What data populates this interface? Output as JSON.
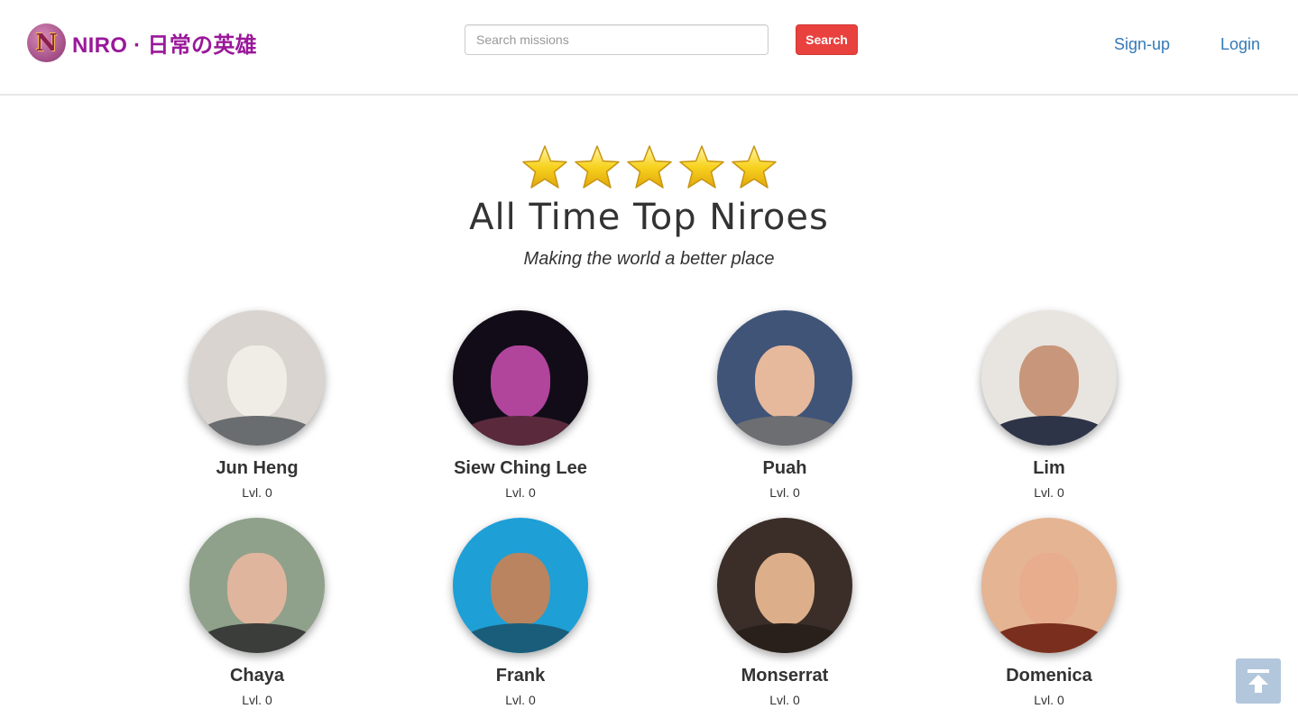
{
  "header": {
    "brand_name": "NIRO · 日常の英雄",
    "brand_logo_letter": "N",
    "search_placeholder": "Search missions",
    "search_value": "",
    "search_button": "Search",
    "signup": "Sign-up",
    "login": "Login"
  },
  "hero": {
    "star_count": 5,
    "title": "All Time Top Niroes",
    "subtitle": "Making the world a better place"
  },
  "heroes": [
    {
      "name": "Jun Heng",
      "level": "Lvl. 0",
      "bg": "#d9d4cf",
      "face": "#f0ece6",
      "body": "#6a6d6f"
    },
    {
      "name": "Siew Ching Lee",
      "level": "Lvl. 0",
      "bg": "#120c18",
      "face": "#b0459b",
      "body": "#5a2a3c"
    },
    {
      "name": "Puah",
      "level": "Lvl. 0",
      "bg": "#3f5477",
      "face": "#e6b89c",
      "body": "#6d6e72"
    },
    {
      "name": "Lim",
      "level": "Lvl. 0",
      "bg": "#e8e4df",
      "face": "#c8967a",
      "body": "#2e3447"
    },
    {
      "name": "Chaya",
      "level": "Lvl. 0",
      "bg": "#8fa18a",
      "face": "#e0b59e",
      "body": "#3b3d3a"
    },
    {
      "name": "Frank",
      "level": "Lvl. 0",
      "bg": "#1e9fd6",
      "face": "#b9845f",
      "body": "#1a5d7a"
    },
    {
      "name": "Monserrat",
      "level": "Lvl. 0",
      "bg": "#3b2e28",
      "face": "#dcae8a",
      "body": "#2a201b"
    },
    {
      "name": "Domenica",
      "level": "Lvl. 0",
      "bg": "#e5b493",
      "face": "#e8ad8c",
      "body": "#7a2f1e"
    }
  ],
  "colors": {
    "brand": "#9a189a",
    "search_button": "#e8413e",
    "nav_link": "#337ab7",
    "back_to_top": "#b3c7dc"
  },
  "icons": {
    "star": "star-icon",
    "back_to_top": "arrow-up-to-line-icon"
  }
}
